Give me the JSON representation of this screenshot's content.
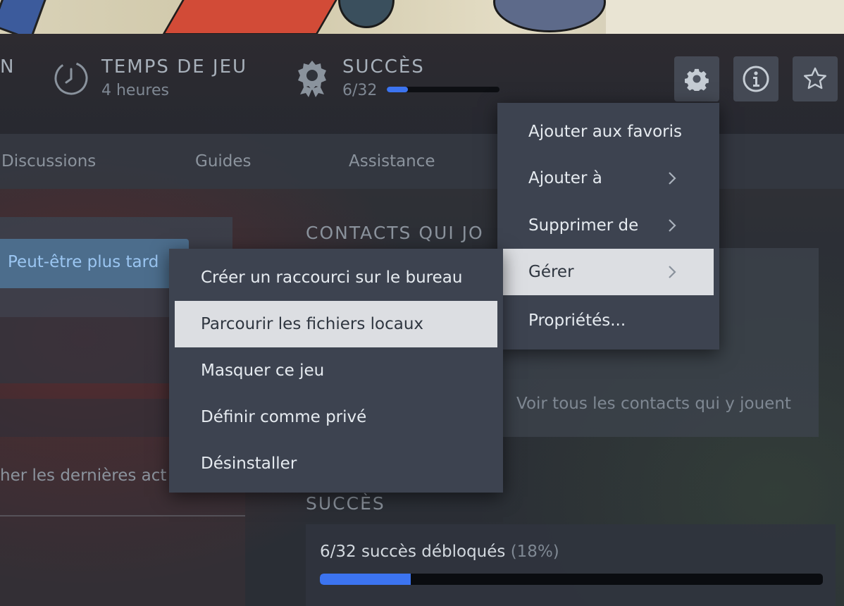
{
  "stats": {
    "cut_label": "N",
    "playtime": {
      "label": "TEMPS DE JEU",
      "value": "4 heures"
    },
    "achievements": {
      "label": "SUCCÈS",
      "value": "6/32",
      "progress": 0.1875
    }
  },
  "header_buttons": {
    "settings_icon": "gear-icon",
    "info_icon": "info-icon",
    "favorite_icon": "star-icon"
  },
  "tabs": [
    {
      "label": "Discussions"
    },
    {
      "label": "Guides"
    },
    {
      "label": "Assistance"
    }
  ],
  "left_panel": {
    "later_button": "Peut-être plus tard",
    "recent_activity": "her les dernières act"
  },
  "friends": {
    "title": "CONTACTS QUI JO",
    "see_all": "Voir tous les contacts qui y jouent"
  },
  "achievements_section": {
    "title": "SUCCÈS",
    "summary": "6/32 succès débloqués",
    "percent": "(18%)",
    "progress": 0.18
  },
  "context_menu": {
    "items": [
      {
        "label": "Ajouter aux favoris"
      },
      {
        "label": "Ajouter à"
      },
      {
        "label": "Supprimer de"
      },
      {
        "label": "Gérer"
      },
      {
        "label": "Propriétés..."
      }
    ]
  },
  "submenu": {
    "items": [
      {
        "label": "Créer un raccourci sur le bureau"
      },
      {
        "label": "Parcourir les fichiers locaux"
      },
      {
        "label": "Masquer ce jeu"
      },
      {
        "label": "Définir comme privé"
      },
      {
        "label": "Désinstaller"
      }
    ]
  },
  "colors": {
    "accent_blue": "#3c74f0",
    "menu_bg": "#3d4350",
    "menu_highlight": "#dcdee2"
  }
}
